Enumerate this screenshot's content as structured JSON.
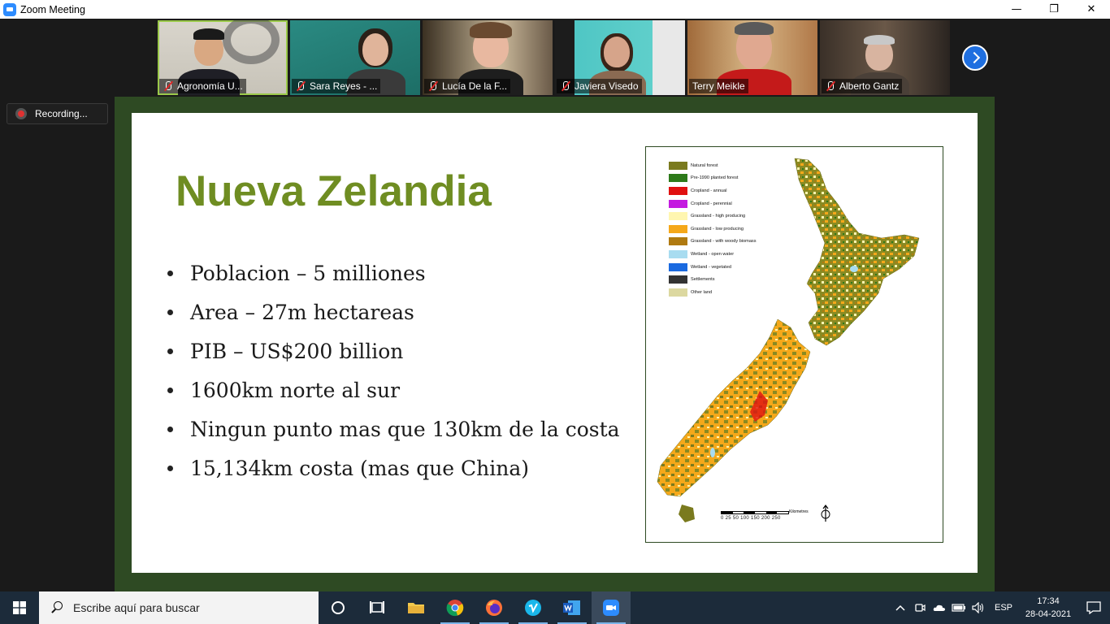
{
  "window": {
    "title": "Zoom Meeting",
    "minimize_glyph": "—",
    "restore_glyph": "❐",
    "close_glyph": "✕"
  },
  "participants": [
    {
      "name": "Agronomía U...",
      "muted": true,
      "active_speaker": true
    },
    {
      "name": "Sara Reyes - ...",
      "muted": true,
      "active_speaker": false
    },
    {
      "name": "Lucía De la F...",
      "muted": true,
      "active_speaker": false
    },
    {
      "name": "Javiera Visedo",
      "muted": true,
      "active_speaker": false
    },
    {
      "name": "Terry Meikle",
      "muted": false,
      "active_speaker": false
    },
    {
      "name": "Alberto Gantz",
      "muted": true,
      "active_speaker": false
    }
  ],
  "recording": {
    "label": "Recording..."
  },
  "slide": {
    "title": "Nueva Zelandia",
    "bullets": [
      "Poblacion – 5 milliones",
      "Area – 27m hectareas",
      "PIB – US$200 billion",
      "1600km norte al sur",
      "Ningun punto mas que 130km de la costa",
      "15,134km costa (mas que China)"
    ],
    "map": {
      "legend": [
        {
          "label": "Natural forest",
          "color": "#7a7a1e"
        },
        {
          "label": "Pre-1990 planted forest",
          "color": "#2d7a1a"
        },
        {
          "label": "Cropland - annual",
          "color": "#e01010"
        },
        {
          "label": "Cropland - perennial",
          "color": "#c41ae0"
        },
        {
          "label": "Grassland - high producing",
          "color": "#fff6b0"
        },
        {
          "label": "Grassland - low producing",
          "color": "#f5a81a"
        },
        {
          "label": "Grassland - with woody biomass",
          "color": "#b07a10"
        },
        {
          "label": "Wetland - open water",
          "color": "#a8dcf0"
        },
        {
          "label": "Wetland - vegetated",
          "color": "#1a6ae0"
        },
        {
          "label": "Settlements",
          "color": "#333333"
        },
        {
          "label": "Other land",
          "color": "#dcd8a0"
        }
      ],
      "scale_ticks": "0  25 50      100     150    200    250",
      "scale_unit": "Kilometres"
    }
  },
  "taskbar": {
    "search_placeholder": "Escribe aquí para buscar",
    "language": "ESP",
    "time": "17:34",
    "date": "28-04-2021"
  }
}
